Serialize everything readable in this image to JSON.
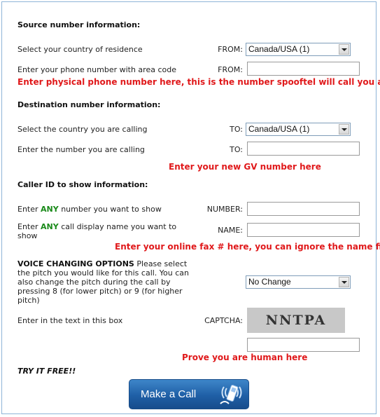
{
  "source": {
    "heading": "Source number information:",
    "country_label": "Select your country of residence",
    "country_from_label": "FROM:",
    "country_value": "Canada/USA (1)",
    "phone_label": "Enter your phone number with area code",
    "phone_from_label": "FROM:",
    "phone_value": "",
    "note": "Enter physical phone number here, this is the number spooftel will call you at"
  },
  "destination": {
    "heading": "Destination number information:",
    "country_label": "Select the country you are calling",
    "country_to_label": "TO:",
    "country_value": "Canada/USA (1)",
    "number_label": "Enter the number you are calling",
    "number_to_label": "TO:",
    "number_value": "",
    "note": "Enter your new GV number here"
  },
  "caller_id": {
    "heading": "Caller ID to show information:",
    "number_label_pre": "Enter ",
    "number_label_any": "ANY",
    "number_label_post": " number you want to show",
    "number_field_label": "NUMBER:",
    "number_value": "",
    "name_label_pre": "Enter ",
    "name_label_any": "ANY",
    "name_label_post": " call display name you want to",
    "name_label_line2": "show",
    "name_field_label": "NAME:",
    "name_value": "",
    "note": "Enter your online fax # here, you can ignore the name field"
  },
  "voice": {
    "heading": "VOICE CHANGING OPTIONS",
    "text": " Please select the pitch you would like for this call. You can also change the pitch during the call by pressing 8 (for lower pitch) or 9 (for higher pitch)",
    "pitch_value": "No Change"
  },
  "captcha": {
    "label": "Enter in the text in this box",
    "field_label": "CAPTCHA:",
    "image_text": "NNTPA",
    "input_value": "",
    "note": "Prove you are human here"
  },
  "footer": {
    "try_free": "TRY IT FREE!!",
    "call_button": "Make a Call"
  }
}
